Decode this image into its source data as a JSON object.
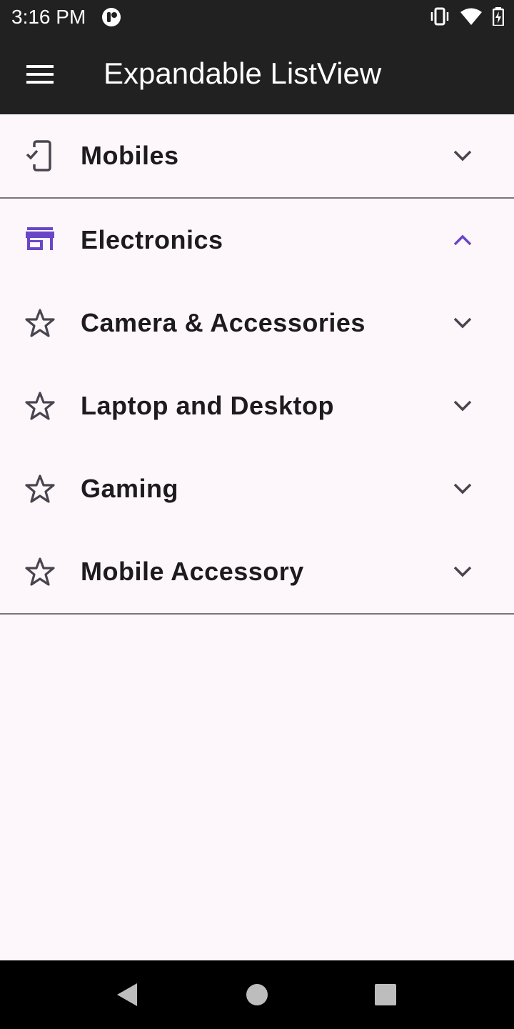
{
  "status_bar": {
    "time": "3:16 PM",
    "icons": [
      "app-notification-icon",
      "vibrate-icon",
      "wifi-icon",
      "battery-icon"
    ],
    "wifi_badge": "4"
  },
  "app_bar": {
    "title": "Expandable ListView",
    "menu_icon": "hamburger-menu-icon"
  },
  "list": {
    "groups": [
      {
        "label": "Mobiles",
        "icon": "mobile-check-icon",
        "expanded": false
      },
      {
        "label": "Electronics",
        "icon": "store-icon",
        "expanded": true,
        "children": [
          {
            "label": "Camera & Accessories",
            "icon": "star-outline-icon",
            "expanded": false
          },
          {
            "label": "Laptop and Desktop",
            "icon": "star-outline-icon",
            "expanded": false
          },
          {
            "label": "Gaming",
            "icon": "star-outline-icon",
            "expanded": false
          },
          {
            "label": "Mobile Accessory",
            "icon": "star-outline-icon",
            "expanded": false
          }
        ]
      }
    ]
  },
  "colors": {
    "app_bar": "#212121",
    "background": "#fdf7fc",
    "accent": "#6a45c8",
    "text": "#1d1b20",
    "divider": "#79747e"
  },
  "nav_bar": {
    "buttons": [
      "back-icon",
      "home-icon",
      "recents-icon"
    ]
  }
}
